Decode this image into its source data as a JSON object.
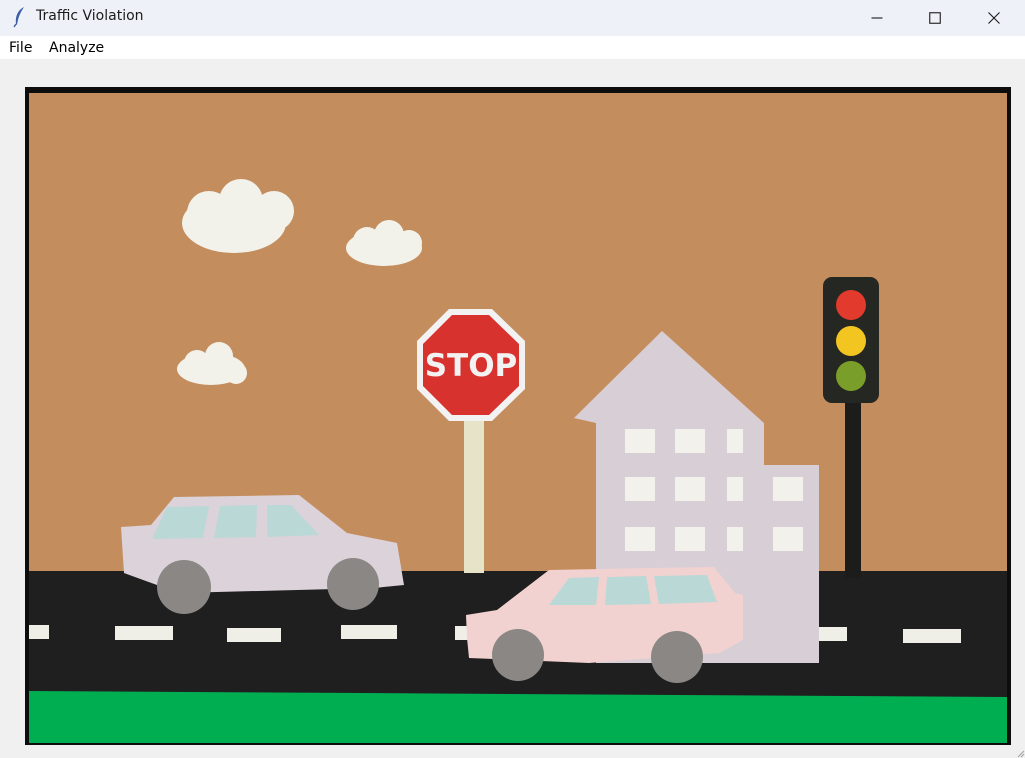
{
  "window": {
    "title": "Traffic Violation",
    "minimize_icon": "minimize-icon",
    "maximize_icon": "maximize-icon",
    "close_icon": "close-icon",
    "app_icon": "feather-icon"
  },
  "menu": {
    "items": [
      {
        "label": "File"
      },
      {
        "label": "Analyze"
      }
    ]
  },
  "canvas": {
    "stop_sign_text": "STOP",
    "colors": {
      "sky": "#c48d5e",
      "road": "#1f1f1f",
      "grass": "#00ae52",
      "stop_red": "#d8322f",
      "house": "#d8cfd6",
      "car_back": "#dcd2da",
      "car_front": "#f2d2d0",
      "wheel": "#8a8784",
      "cloud": "#f2f2ea",
      "light_red": "#e23a2c",
      "light_yellow": "#f2c521",
      "light_green": "#7a9e2a"
    }
  }
}
